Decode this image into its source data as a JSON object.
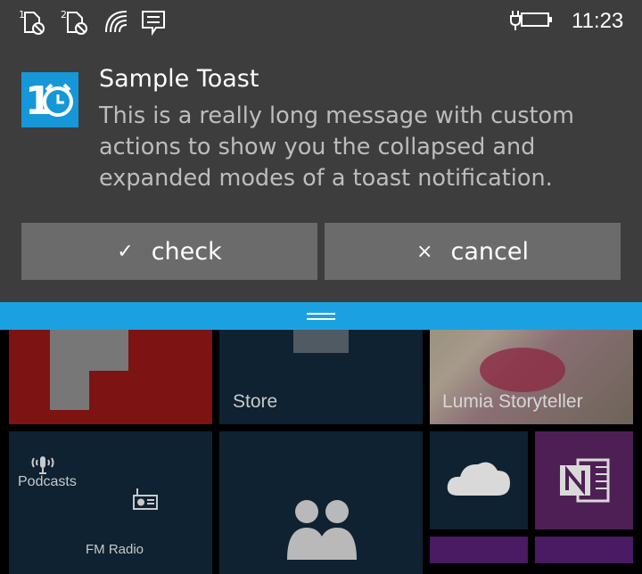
{
  "status_bar": {
    "sim1_label": "1",
    "sim2_label": "2",
    "time": "11:23",
    "icons": [
      "sim-no-service-icon",
      "sim-no-service-icon",
      "wifi-icon",
      "message-icon",
      "battery-charging-icon"
    ]
  },
  "toast": {
    "app_icon": "alarm-clock-app-icon",
    "app_icon_text": "1",
    "title": "Sample Toast",
    "body": "This is a really long message with custom actions to show you the collapsed and expanded modes of a toast notification.",
    "actions": [
      {
        "glyph": "✓",
        "label": "check"
      },
      {
        "glyph": "×",
        "label": "cancel"
      }
    ]
  },
  "tiles": {
    "store": "Store",
    "storyteller": "Lumia Storyteller",
    "podcasts": "Podcasts",
    "fm_radio": "FM Radio"
  },
  "colors": {
    "panel": "#3d3d3d",
    "accent": "#1ba1e2",
    "button": "#6b6b6b"
  }
}
